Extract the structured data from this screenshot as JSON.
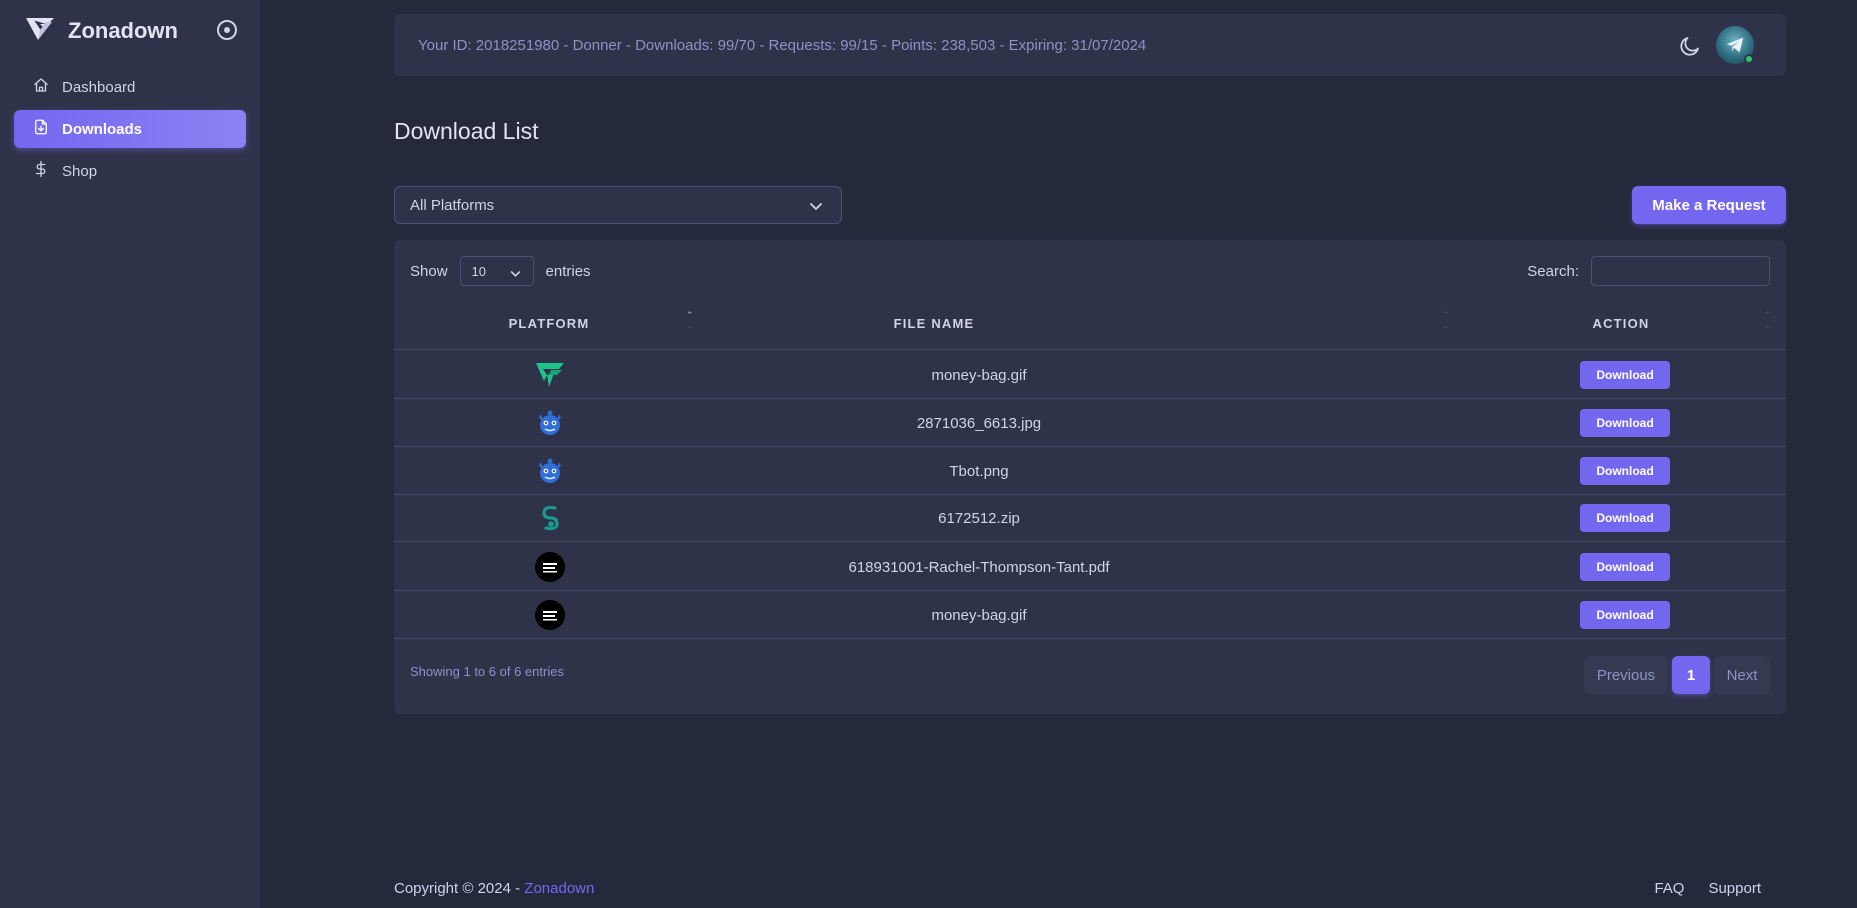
{
  "app": {
    "name": "Zonadown"
  },
  "sidebar": {
    "items": [
      {
        "label": "Dashboard",
        "icon": "home-icon",
        "active": false
      },
      {
        "label": "Downloads",
        "icon": "file-download-icon",
        "active": true
      },
      {
        "label": "Shop",
        "icon": "dollar-icon",
        "active": false
      }
    ]
  },
  "topbar": {
    "info": "Your ID: 2018251980 - Donner - Downloads: 99/70 - Requests: 99/15 - Points: 238,503 - Expiring: 31/07/2024",
    "theme_icon": "moon-icon",
    "avatar_status": "online"
  },
  "page": {
    "title": "Download List"
  },
  "filter": {
    "selected": "All Platforms"
  },
  "actions": {
    "request_label": "Make a Request"
  },
  "table": {
    "show_label": "Show",
    "entries_value": "10",
    "entries_label": "entries",
    "search_label": "Search:",
    "columns": [
      "PLATFORM",
      "FILE NAME",
      "ACTION"
    ],
    "rows": [
      {
        "platform_icon": "freepik-icon",
        "file": "money-bag.gif",
        "action": "Download"
      },
      {
        "platform_icon": "monster-icon",
        "file": "2871036_6613.jpg",
        "action": "Download"
      },
      {
        "platform_icon": "monster-icon",
        "file": "Tbot.png",
        "action": "Download"
      },
      {
        "platform_icon": "envato-icon",
        "file": "6172512.zip",
        "action": "Download"
      },
      {
        "platform_icon": "skillshare-icon",
        "file": "618931001-Rachel-Thompson-Tant.pdf",
        "action": "Download"
      },
      {
        "platform_icon": "skillshare-icon",
        "file": "money-bag.gif",
        "action": "Download"
      }
    ],
    "info": "Showing 1 to 6 of 6 entries",
    "pagination": {
      "previous": "Previous",
      "current": "1",
      "next": "Next"
    }
  },
  "footer": {
    "copyright": "Copyright © 2024 - ",
    "brand": "Zonadown",
    "links": [
      "FAQ",
      "Support"
    ]
  },
  "colors": {
    "accent": "#7367f0",
    "background": "#25293c",
    "surface": "#2f3349",
    "online": "#28c76f"
  }
}
